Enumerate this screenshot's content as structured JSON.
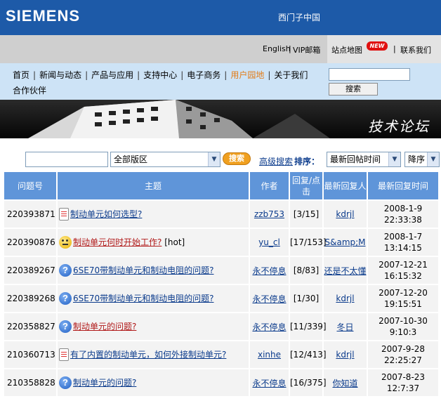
{
  "header": {
    "logo": "SIEMENS",
    "site_title": "西门子中国"
  },
  "utility": {
    "lang": "English",
    "vip_mail": "VIP邮箱",
    "sep": "|",
    "sitemap": "站点地图",
    "new_badge": "NEW",
    "contact": "联系我们"
  },
  "nav": {
    "row1": [
      "首页",
      "新闻与动态",
      "产品与应用",
      "支持中心",
      "电子商务",
      "用户园地",
      "关于我们"
    ],
    "row2": [
      "合作伙伴"
    ],
    "active": "用户园地",
    "search_button": "搜索"
  },
  "banner": {
    "title": "技术论坛"
  },
  "toolbar": {
    "board_select": "全部版区",
    "search_button": "搜索",
    "advanced": "高级搜索",
    "sort_label": "排序：",
    "sort_field": "最新回帖时间",
    "sort_order": "降序"
  },
  "table": {
    "headers": [
      "问题号",
      "主题",
      "作者",
      "回复/点击",
      "最新回复人",
      "最新回复时间"
    ],
    "rows": [
      {
        "id": "220393871",
        "icon": "document-icon",
        "topic": "制动单元如何选型?",
        "hot": false,
        "author": "zzb753",
        "stats": "[3/15]",
        "last_user": "kdrjl",
        "date": "2008-1-9",
        "time": "22:33:38"
      },
      {
        "id": "220390876",
        "icon": "smiley-icon",
        "topic": "制动单元何时开始工作?",
        "hot": true,
        "hot_tag": "[hot]",
        "author": "yu_cl",
        "stats": "[17/153]",
        "last_user": "S&amp;M",
        "date": "2008-1-7",
        "time": "13:14:15"
      },
      {
        "id": "220389267",
        "icon": "question-icon",
        "topic": "6SE70带制动单元和制动电阻的问题?",
        "hot": false,
        "author": "永不停息",
        "stats": "[8/83]",
        "last_user": "还是不太懂",
        "date": "2007-12-21",
        "time": "16:15:32"
      },
      {
        "id": "220389268",
        "icon": "question-icon",
        "topic": "6SE70带制动单元和制动电阻的问题?",
        "hot": false,
        "author": "永不停息",
        "stats": "[1/30]",
        "last_user": "kdrjl",
        "date": "2007-12-20",
        "time": "19:15:51"
      },
      {
        "id": "220358827",
        "icon": "question-icon",
        "topic": "制动单元的问题?",
        "hot": true,
        "hot_tag": "",
        "author": "永不停息",
        "stats": "[11/339]",
        "last_user": "冬日",
        "date": "2007-10-30",
        "time": "9:10:3"
      },
      {
        "id": "210360713",
        "icon": "document-icon",
        "topic": "有了内置的制动单元，如何外接制动单元?",
        "hot": false,
        "author": "xinhe",
        "stats": "[12/413]",
        "last_user": "kdrjl",
        "date": "2007-9-28",
        "time": "22:25:27"
      },
      {
        "id": "210358828",
        "icon": "question-icon",
        "topic": "制动单元的问题?",
        "hot": false,
        "author": "永不停息",
        "stats": "[16/375]",
        "last_user": "你知道",
        "date": "2007-8-23",
        "time": "12:7:37"
      }
    ]
  },
  "colors": {
    "header_blue": "#1d5aa8",
    "nav_bg": "#cde3f6",
    "table_header": "#5f95d9",
    "link": "#0b3b8c",
    "active_nav": "#e27b16"
  }
}
